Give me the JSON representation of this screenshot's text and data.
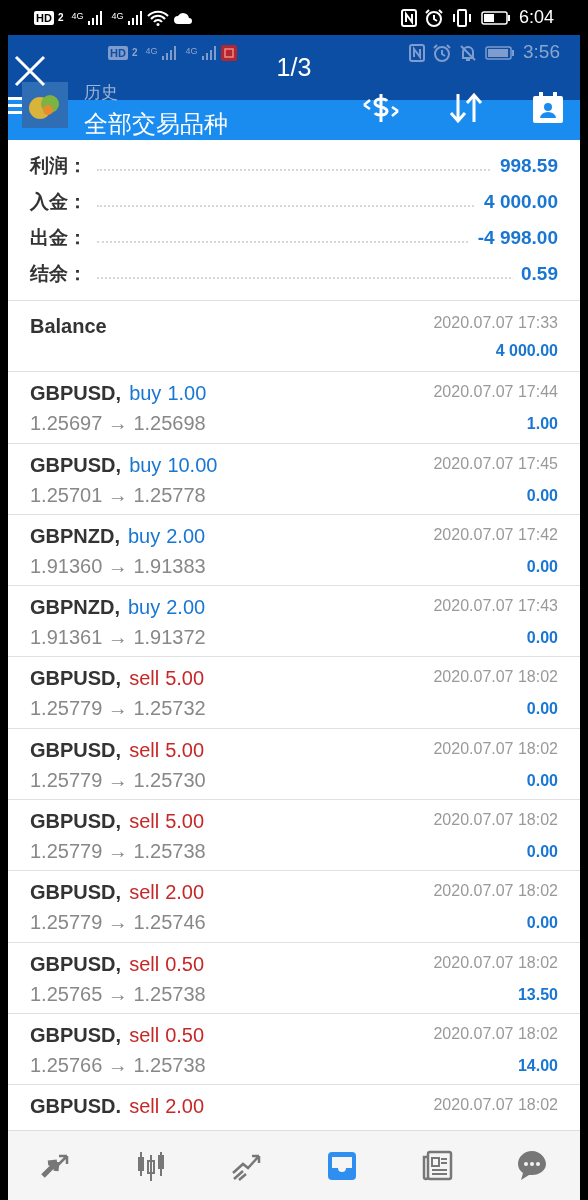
{
  "status_bar": {
    "hd_label": "HD",
    "hd_sim": "2",
    "networks": [
      "4G",
      "4G"
    ],
    "time": "6:04"
  },
  "viewer": {
    "counter": "1/3"
  },
  "inner_status_bar": {
    "hd_label": "HD",
    "hd_sim": "2",
    "networks": [
      "4G",
      "4G"
    ],
    "time": "3:56"
  },
  "header": {
    "subtitle": "历史",
    "title": "全部交易品种"
  },
  "summary": [
    {
      "label": "利润：",
      "value": "998.59"
    },
    {
      "label": "入金：",
      "value": "4 000.00"
    },
    {
      "label": "出金：",
      "value": "-4 998.00"
    },
    {
      "label": "结余：",
      "value": "0.59"
    }
  ],
  "balance": {
    "label": "Balance",
    "time": "2020.07.07 17:33",
    "amount": "4 000.00"
  },
  "trades": [
    {
      "symbol": "GBPUSD,",
      "side": "buy",
      "volume": "1.00",
      "prices": "1.25697 → 1.25698",
      "time": "2020.07.07 17:44",
      "profit": "1.00"
    },
    {
      "symbol": "GBPUSD,",
      "side": "buy",
      "volume": "10.00",
      "prices": "1.25701 → 1.25778",
      "time": "2020.07.07 17:45",
      "profit": "0.00"
    },
    {
      "symbol": "GBPNZD,",
      "side": "buy",
      "volume": "2.00",
      "prices": "1.91360 → 1.91383",
      "time": "2020.07.07 17:42",
      "profit": "0.00"
    },
    {
      "symbol": "GBPNZD,",
      "side": "buy",
      "volume": "2.00",
      "prices": "1.91361 → 1.91372",
      "time": "2020.07.07 17:43",
      "profit": "0.00"
    },
    {
      "symbol": "GBPUSD,",
      "side": "sell",
      "volume": "5.00",
      "prices": "1.25779 → 1.25732",
      "time": "2020.07.07 18:02",
      "profit": "0.00"
    },
    {
      "symbol": "GBPUSD,",
      "side": "sell",
      "volume": "5.00",
      "prices": "1.25779 → 1.25730",
      "time": "2020.07.07 18:02",
      "profit": "0.00"
    },
    {
      "symbol": "GBPUSD,",
      "side": "sell",
      "volume": "5.00",
      "prices": "1.25779 → 1.25738",
      "time": "2020.07.07 18:02",
      "profit": "0.00"
    },
    {
      "symbol": "GBPUSD,",
      "side": "sell",
      "volume": "2.00",
      "prices": "1.25779 → 1.25746",
      "time": "2020.07.07 18:02",
      "profit": "0.00"
    },
    {
      "symbol": "GBPUSD,",
      "side": "sell",
      "volume": "0.50",
      "prices": "1.25765 → 1.25738",
      "time": "2020.07.07 18:02",
      "profit": "13.50"
    },
    {
      "symbol": "GBPUSD,",
      "side": "sell",
      "volume": "0.50",
      "prices": "1.25766 → 1.25738",
      "time": "2020.07.07 18:02",
      "profit": "14.00"
    },
    {
      "symbol": "GBPUSD.",
      "side": "sell",
      "volume": "2.00",
      "time": "2020.07.07 18:02"
    }
  ],
  "bottom_nav": [
    {
      "kind": "quotes",
      "selected": false
    },
    {
      "kind": "chart",
      "selected": false
    },
    {
      "kind": "trade",
      "selected": false
    },
    {
      "kind": "history",
      "selected": true
    },
    {
      "kind": "news",
      "selected": false
    },
    {
      "kind": "chat",
      "selected": false
    }
  ]
}
